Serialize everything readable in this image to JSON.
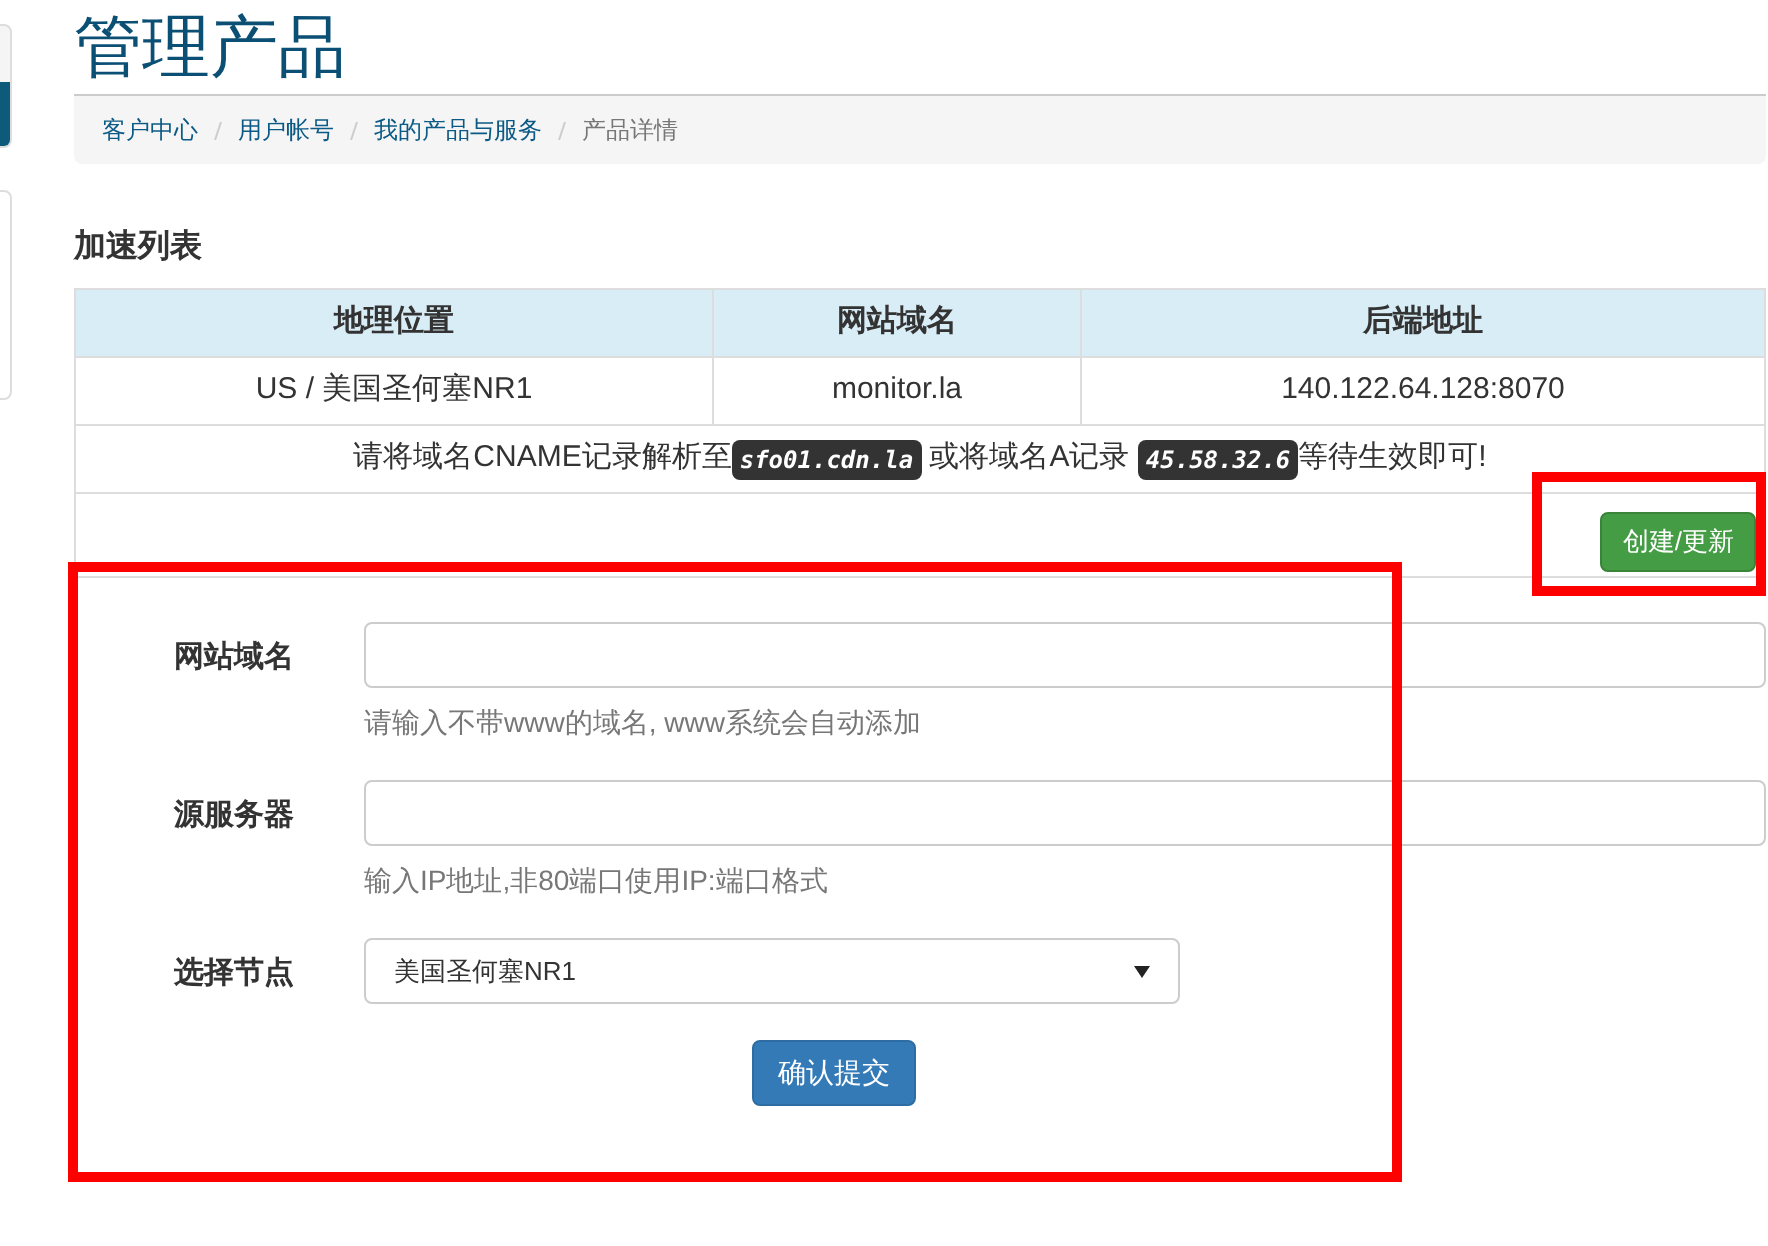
{
  "page_title": "管理产品",
  "breadcrumb": [
    {
      "label": "客户中心",
      "link": true
    },
    {
      "label": "用户帐号",
      "link": true
    },
    {
      "label": "我的产品与服务",
      "link": true
    },
    {
      "label": "产品详情",
      "link": false
    }
  ],
  "section_title": "加速列表",
  "table": {
    "columns": [
      "地理位置",
      "网站域名",
      "后端地址"
    ],
    "rows": [
      [
        "US / 美国圣何塞NR1",
        "monitor.la",
        "140.122.64.128:8070"
      ]
    ],
    "notice": [
      {
        "kind": "text",
        "text": "请将域名CNAME记录解析至"
      },
      {
        "kind": "code",
        "text": "sfo01.cdn.la"
      },
      {
        "kind": "text",
        "text": " 或将域名A记录 "
      },
      {
        "kind": "code",
        "text": "45.58.32.6"
      },
      {
        "kind": "text",
        "text": "等待生效即可!"
      }
    ],
    "action_button": "创建/更新"
  },
  "form": {
    "fields": [
      {
        "kind": "input",
        "label": "网站域名",
        "help": "请输入不带www的域名, www系统会自动添加"
      },
      {
        "kind": "input",
        "label": "源服务器",
        "help": "输入IP地址,非80端口使用IP:端口格式"
      },
      {
        "kind": "select",
        "label": "选择节点",
        "value": "美国圣何塞NR1"
      }
    ],
    "submit": "确认提交"
  }
}
